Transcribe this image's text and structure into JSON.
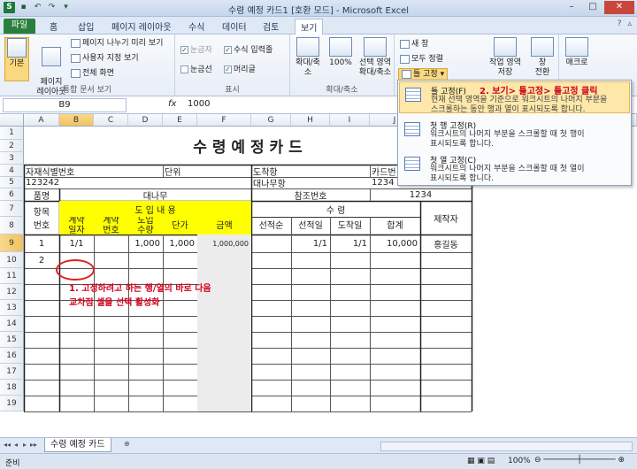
{
  "window": {
    "title": "수령 예정 카드1 [호환 모드] - Microsoft Excel",
    "qat": [
      "S",
      "↶",
      "↷",
      "▾"
    ]
  },
  "tabs": {
    "file": "파일",
    "items": [
      "홈",
      "삽입",
      "페이지 레이아웃",
      "수식",
      "데이터",
      "검토",
      "보기"
    ],
    "active": "보기"
  },
  "ribbon": {
    "workbook_views": {
      "normal": "기본",
      "page_layout": "페이지\n레이아웃",
      "page_break": "페이지 나누기 미리 보기",
      "custom": "사용자 지정 보기",
      "full": "전체 화면",
      "label": "통합 문서 보기"
    },
    "show": {
      "ruler": "눈금자",
      "formula_bar": "수식 입력줄",
      "gridlines": "눈금선",
      "headings": "머리글",
      "label": "표시"
    },
    "zoom": {
      "zoom": "확대/축소",
      "z100": "100%",
      "selection": "선택 영역\n확대/축소",
      "label": "확대/축소"
    },
    "window": {
      "new": "새 창",
      "arrange": "모두 정렬",
      "freeze": "틀 고정",
      "save_ws": "작업 영역\n저장",
      "switch": "창\n전환"
    },
    "macro": {
      "label": "매크로"
    }
  },
  "formula_bar": {
    "name_box": "B9",
    "fx": "fx",
    "value": "1000"
  },
  "columns": [
    "A",
    "B",
    "C",
    "D",
    "E",
    "F",
    "G",
    "H",
    "I",
    "J",
    "K"
  ],
  "rows": [
    "1",
    "2",
    "3",
    "4",
    "5",
    "6",
    "7",
    "8",
    "9",
    "10",
    "11",
    "12",
    "13",
    "14",
    "15",
    "16",
    "17",
    "18",
    "19"
  ],
  "sheet": {
    "title": "수 령 예 정 카 드",
    "r4": {
      "a": "자재식별번호",
      "e": "단위",
      "g": "도착항",
      "j": "카드번"
    },
    "r5": {
      "a": "123242",
      "g": "대나무항",
      "j": "1234"
    },
    "r6": {
      "a": "품명",
      "c": "대나무",
      "g": "참조번호",
      "j": "1234"
    },
    "r7": {
      "item_no": "항목\n번호",
      "entry": "도 입 내 용",
      "qty": "수          령",
      "author": "제작자"
    },
    "r8": {
      "b": "계약\n일자",
      "c": "계약\n번호",
      "d": "도입\n수량",
      "e": "단가",
      "f": "금액",
      "g": "선적순",
      "h": "선적일",
      "i": "도착일",
      "j": "합계"
    },
    "r9": {
      "a": "1",
      "b": "1/1",
      "d": "1,000",
      "e": "1,000",
      "f": "1,000,000",
      "h": "1/1",
      "i": "1/1",
      "j": "10,000",
      "k": "홍길동"
    },
    "r10": {
      "a": "2"
    }
  },
  "annotations": {
    "step1": "1. 고정하려고 하는 행/열의 바로 다음\n교차점 셀을 선택 활성화",
    "step2": "2. 보기> 틀고정> 틀고정 클릭"
  },
  "freeze_menu": [
    {
      "title": "틀 고정(F)",
      "desc": "현재 선택 영역을 기준으로 워크시트의 나머지 부분을\n스크롤하는 동안 행과 열이 표시되도록 합니다."
    },
    {
      "title": "첫 행 고정(R)",
      "desc": "워크시트의 나머지 부분을 스크롤할 때 첫 행이\n표시되도록 합니다."
    },
    {
      "title": "첫 열 고정(C)",
      "desc": "워크시트의 나머지 부분을 스크롤할 때 첫 열이\n표시되도록 합니다."
    }
  ],
  "sheet_tabs": {
    "active": "수령 예정 카드",
    "nav": [
      "◂◂",
      "◂",
      "▸",
      "▸▸"
    ]
  },
  "status": {
    "ready": "준비",
    "zoom": "100%"
  }
}
